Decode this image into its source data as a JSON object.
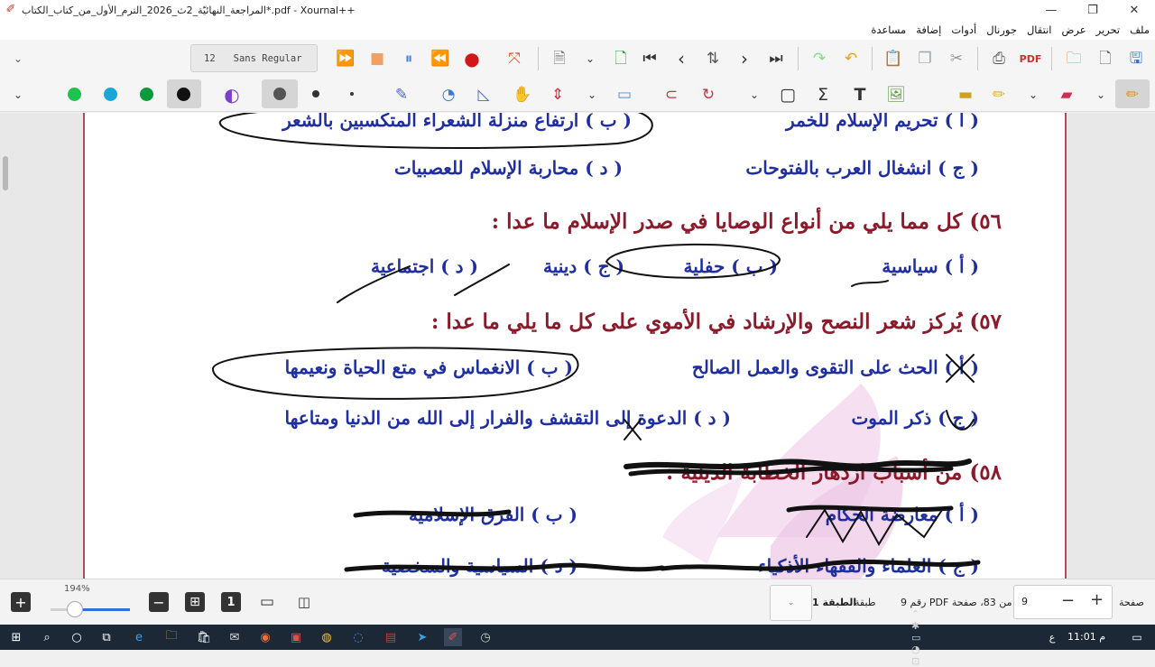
{
  "window": {
    "title": "المراجعة_النهائيّة_2ث_2026_الترم_الأول_من_كتاب_الكتاب*.pdf - Xournal++",
    "minimize": "—",
    "restore": "❐",
    "close": "✕"
  },
  "menu": [
    "ملف",
    "تحرير",
    "عرض",
    "انتقال",
    "جورنال",
    "أدوات",
    "إضافة",
    "مساعدة"
  ],
  "toolbar": {
    "font_size": "12",
    "font_name": "Sans Regular",
    "colors": {
      "green": "#1fc24a",
      "cyan": "#1aa7d6",
      "dark_green": "#0c9b3a",
      "black": "#111111",
      "purple": "#7b3fc9",
      "record_red": "#d01818",
      "accent_blue": "#2b73d6"
    }
  },
  "document": {
    "q55_options": {
      "a": "( أ ) تحريم الإسلام للخمر",
      "b": "( ب ) ارتفاع منزلة الشعراء المتكسبين بالشعر",
      "c": "( ج ) انشغال العرب بالفتوحات",
      "d": "( د ) محاربة الإسلام للعصبيات"
    },
    "q56": {
      "question": "٥٦) كل مما يلي من أنواع الوصايا في صدر الإسلام ما عدا :",
      "a": "( أ ) سياسية",
      "b": "( ب ) حفلية",
      "c": "( ج ) دينية",
      "d": "( د ) اجتماعية"
    },
    "q57": {
      "question": "٥٧) يُركز شعر النصح والإرشاد في الأموي على كل ما يلي ما عدا :",
      "a": "( أ ) الحث على التقوى والعمل الصالح",
      "b": "( ب ) الانغماس في متع الحياة ونعيمها",
      "c": "( ج ) ذكر الموت",
      "d": "( د ) الدعوة إلى التقشف والفرار إلى الله من الدنيا ومتاعها"
    },
    "q58": {
      "question": "٥٨) من أسباب ازدهار الخطابة الدينية :",
      "a": "( أ ) معارضة الحكام",
      "b": "( ب ) الفرق الإسلامية",
      "c": "( ج ) العلماء والفقهاء الأذكياء",
      "d": "( د ) السياسية والسخصية"
    }
  },
  "bottom": {
    "zoom": "194%",
    "layer_label": "طبقة",
    "layer_value": "الطبقة 1",
    "pdf_info": "من 83، صفحة PDF رقم 9",
    "page_value": "9",
    "page_label": "صفحة",
    "minus": "−",
    "plus": "+"
  },
  "taskbar": {
    "time": "11:01 م",
    "lang": "ع"
  }
}
